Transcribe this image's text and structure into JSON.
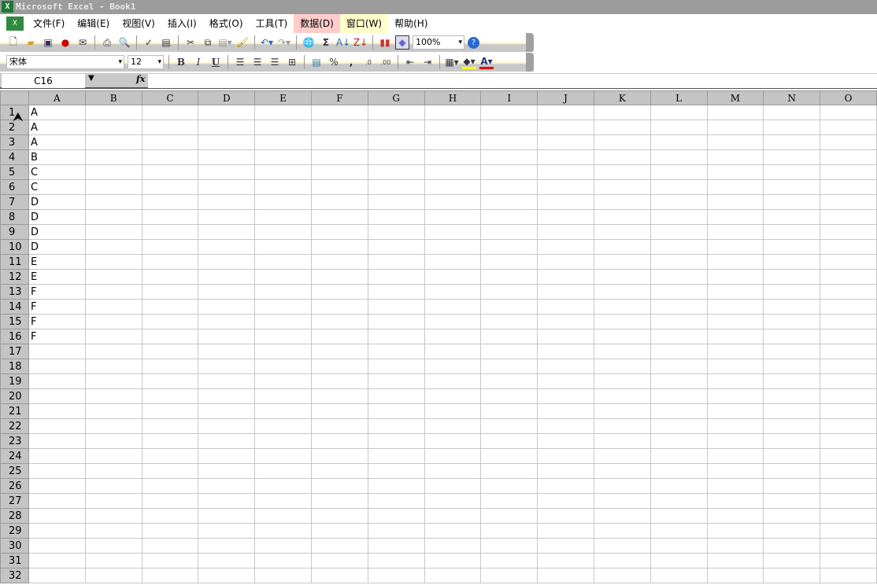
{
  "title": "Microsoft Excel - Book1",
  "menu": [
    "文件(F)",
    "编辑(E)",
    "视图(V)",
    "插入(I)",
    "格式(O)",
    "工具(T)",
    "数据(D)",
    "窗口(W)",
    "帮助(H)"
  ],
  "toolbar": {
    "zoom": "100%",
    "font": "宋体",
    "size": "12",
    "sigma": "Σ",
    "percent": "%",
    "comma": ",",
    "bold": "B",
    "italic": "I",
    "underline": "U"
  },
  "formula_bar": {
    "name_box": "C16",
    "fx": "fx",
    "value": ""
  },
  "columns": [
    "A",
    "B",
    "C",
    "D",
    "E",
    "F",
    "G",
    "H",
    "I",
    "J",
    "K",
    "L",
    "M",
    "N",
    "O"
  ],
  "rows": 32,
  "col_a_values": [
    "A",
    "A",
    "A",
    "B",
    "C",
    "C",
    "D",
    "D",
    "D",
    "D",
    "E",
    "E",
    "F",
    "F",
    "F",
    "F"
  ]
}
